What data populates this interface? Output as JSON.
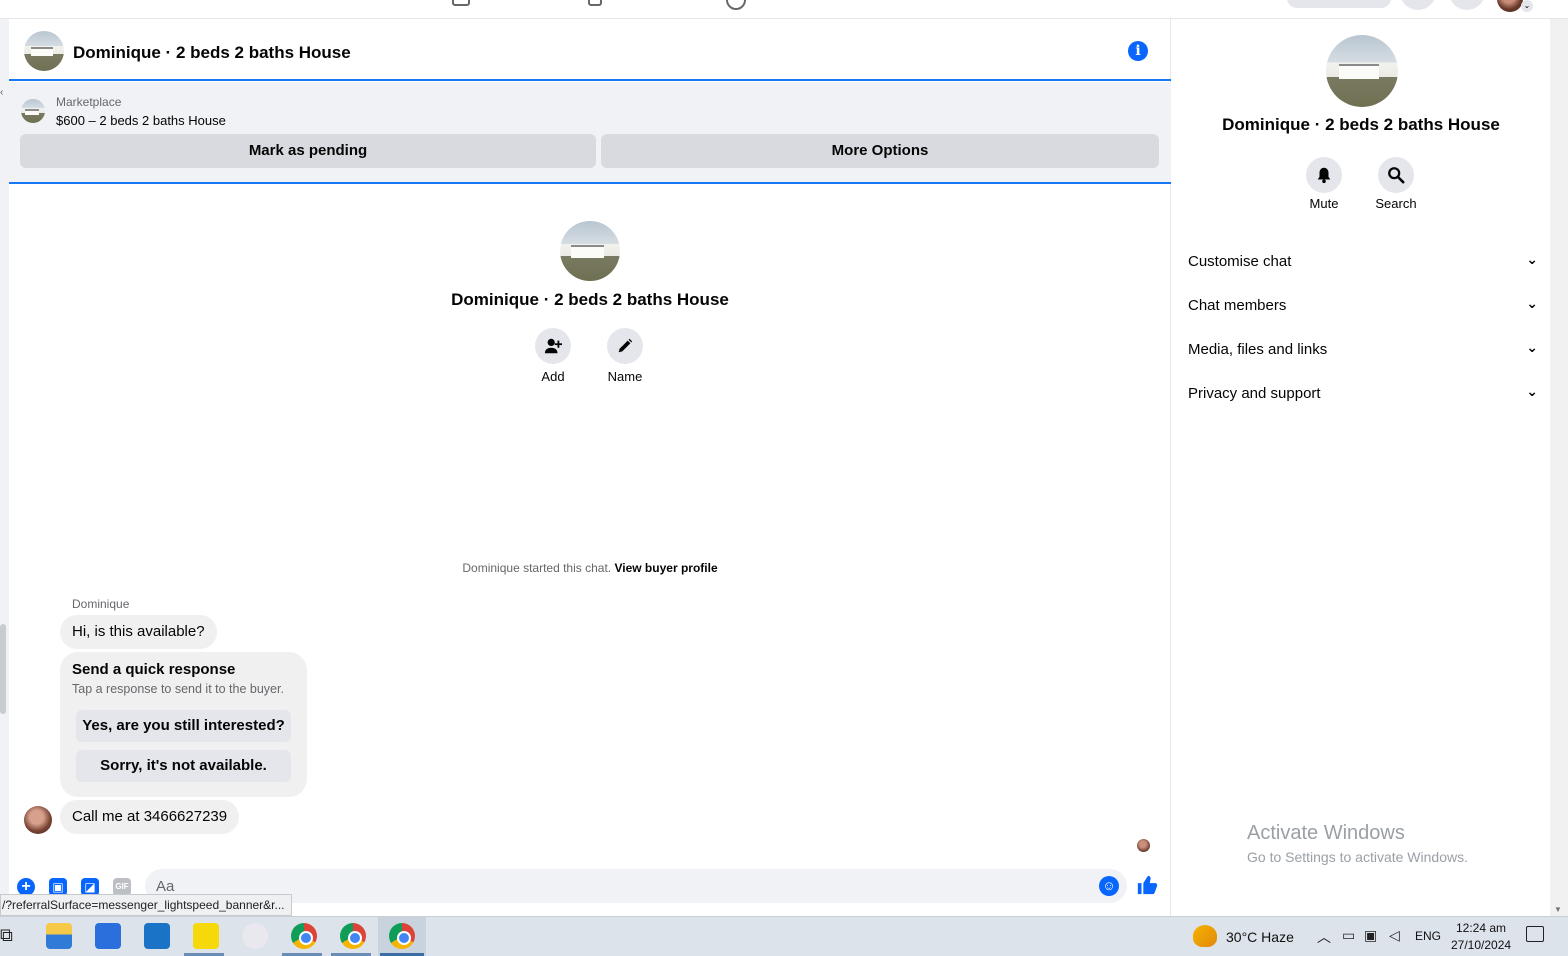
{
  "chat": {
    "title": "Dominique · 2 beds 2 baths House",
    "marketplace_label": "Marketplace",
    "listing": "$600 – 2 beds 2 baths House",
    "mark_pending_label": "Mark as pending",
    "more_options_label": "More Options",
    "intro_title": "Dominique · 2 beds 2 baths House",
    "add_label": "Add",
    "name_label": "Name",
    "started_text": "Dominique started this chat.",
    "view_profile_label": "View buyer profile",
    "sender_name": "Dominique",
    "messages": [
      {
        "text": "Hi, is this available?"
      },
      {
        "text": "Call me at 3466627239"
      }
    ],
    "quick_response": {
      "title": "Send a quick response",
      "subtitle": "Tap a response to send it to the buyer.",
      "options": [
        "Yes, are you still interested?",
        "Sorry, it's not available."
      ]
    },
    "composer_placeholder": "Aa",
    "gif_label": "GIF",
    "status_url": "/?referralSurface=messenger_lightspeed_banner&r..."
  },
  "info_panel": {
    "title": "Dominique · 2 beds 2 baths House",
    "mute_label": "Mute",
    "search_label": "Search",
    "sections": [
      {
        "label": "Customise chat"
      },
      {
        "label": "Chat members"
      },
      {
        "label": "Media, files and links"
      },
      {
        "label": "Privacy and support"
      }
    ]
  },
  "watermark": {
    "title": "Activate Windows",
    "subtitle": "Go to Settings to activate Windows."
  },
  "taskbar": {
    "weather": "30°C  Haze",
    "lang": "ENG",
    "time": "12:24 am",
    "date": "27/10/2024"
  },
  "colors": {
    "accent": "#0866ff",
    "banner_border": "#1877f2",
    "bubble": "#f0f0f0"
  },
  "icons": [
    "info-icon",
    "add-person-icon",
    "pencil-icon",
    "bell-icon",
    "search-icon",
    "chevron-down-icon",
    "plus-icon",
    "photo-icon",
    "sticker-icon",
    "gif-icon",
    "emoji-icon",
    "thumbs-up-icon"
  ]
}
